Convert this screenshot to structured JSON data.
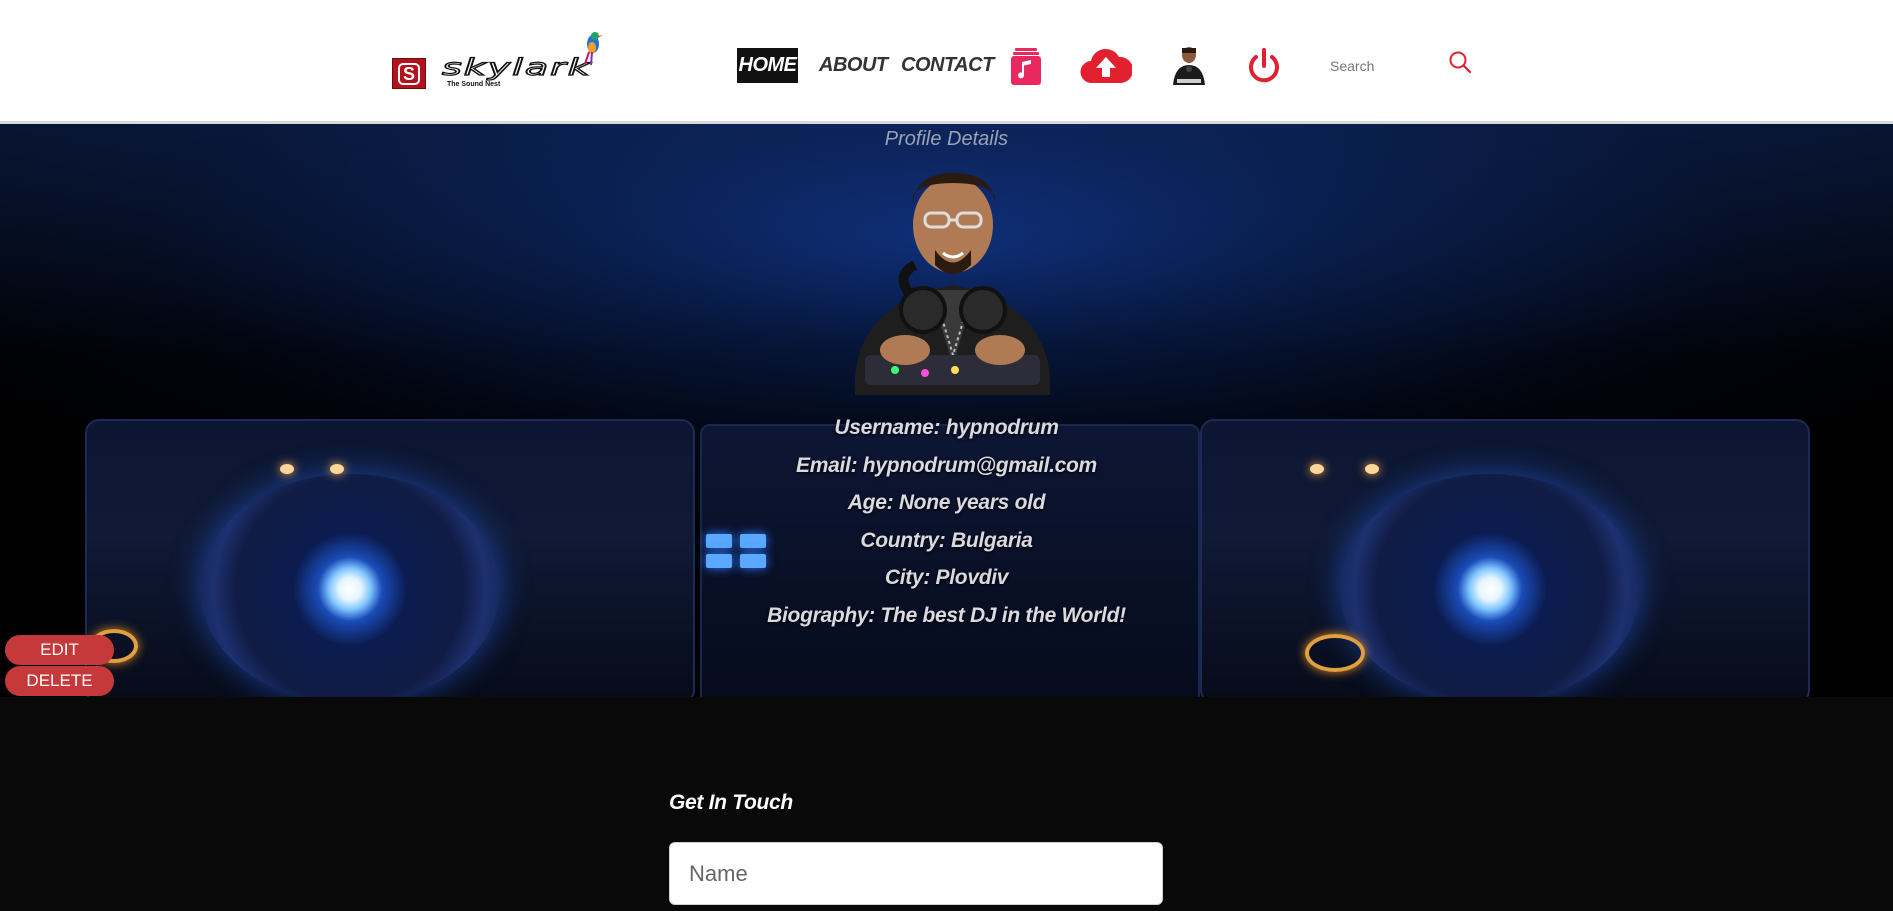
{
  "brand": {
    "logo_letter": "S",
    "logo_text": "skylark",
    "tagline": "The Sound Nest"
  },
  "nav": {
    "home": "HOME",
    "about": "ABOUT",
    "contact": "CONTACT",
    "icons": [
      "music-icon",
      "cloud-upload-icon",
      "user-avatar-icon",
      "power-icon"
    ]
  },
  "search": {
    "placeholder": "Search"
  },
  "profile": {
    "title": "Profile Details",
    "username": "Username: hypnodrum",
    "email": "Email: hypnodrum@gmail.com",
    "age": "Age: None years old",
    "country": "Country: Bulgaria",
    "city": "City: Plovdiv",
    "biography": "Biography: The best DJ in the World!"
  },
  "actions": {
    "edit": "EDIT",
    "delete": "DELETE"
  },
  "contact": {
    "title": "Get In Touch",
    "name_placeholder": "Name"
  },
  "colors": {
    "accent_red": "#e3212e",
    "button_red": "#c5393a",
    "music_pink": "#e8285f",
    "footer_bg": "#0a0909"
  }
}
